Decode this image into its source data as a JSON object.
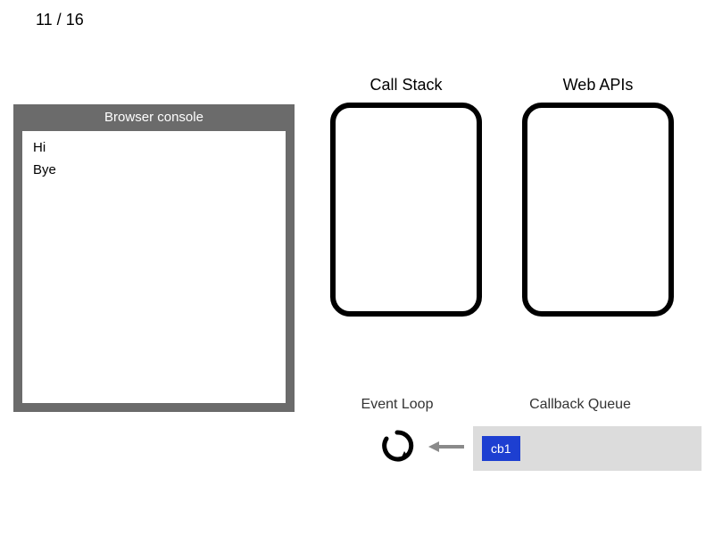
{
  "pagination": {
    "text": "11 / 16"
  },
  "console": {
    "title": "Browser console",
    "lines": [
      "Hi",
      "Bye"
    ]
  },
  "sections": {
    "call_stack": "Call Stack",
    "web_apis": "Web APIs",
    "event_loop": "Event Loop",
    "callback_queue": "Callback Queue"
  },
  "callback_queue": {
    "items": [
      "cb1"
    ]
  },
  "colors": {
    "panel_gray": "#6b6b6b",
    "queue_bg": "#dcdcdc",
    "cb_blue": "#1d3fd1"
  }
}
